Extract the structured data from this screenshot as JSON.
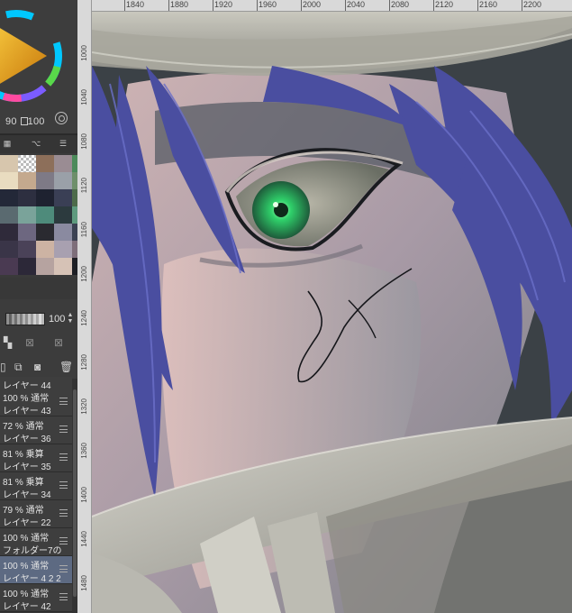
{
  "color_panel": {
    "saturation": "90",
    "brightness": "100",
    "brightness_icon": "square-icon",
    "current_color": "#e0a020"
  },
  "palette_tabs": [
    "grid-icon",
    "branch-icon",
    "sliders-icon"
  ],
  "swatches": [
    [
      "#d7c6ad",
      "#b9a187",
      "#8d6f5a",
      "#9a8c93",
      "#4c8a5a"
    ],
    [
      "#e9dcc0",
      "#c4a98e",
      "#7e7a86",
      "#9aa0a8",
      "#6e8f6a"
    ],
    [
      "#232838",
      "#2d2f40",
      "#1e2230",
      "#3a3f55",
      "#4d6b4a"
    ],
    [
      "#5a6a70",
      "#7aa39a",
      "#4e8b7b",
      "#2c3a3e",
      "#5f9b7f"
    ],
    [
      "#2f2a3a",
      "#6d6780",
      "#2a2a30",
      "#8a8aa0",
      "#3b4152"
    ],
    [
      "#3a3548",
      "#4a4258",
      "#cdb3a3",
      "#a8a0b0",
      "#7e6e7a"
    ],
    [
      "#4a3a52",
      "#2c2838",
      "#b6a3a0",
      "#d6c2b6",
      "#1d1e24"
    ]
  ],
  "layer_panel": {
    "opacity_value": "100",
    "layers": [
      {
        "mode": "",
        "name": "レイヤー 44"
      },
      {
        "mode": "100 %  通常",
        "name": "レイヤー 43"
      },
      {
        "mode": "72 %  通常",
        "name": "レイヤー 36"
      },
      {
        "mode": "81 %  乗算",
        "name": "レイヤー 35"
      },
      {
        "mode": "81 %  乗算",
        "name": "レイヤー 34"
      },
      {
        "mode": "79 %  通常",
        "name": "レイヤー 22"
      },
      {
        "mode": "100 %  通常",
        "name": "フォルダー7の"
      },
      {
        "mode": "100 %  通常",
        "name": "レイヤー 4 2 2",
        "selected": true
      },
      {
        "mode": "100 %  通常",
        "name": "レイヤー 42"
      }
    ]
  },
  "rulers": {
    "horizontal": [
      "1840",
      "1880",
      "1920",
      "1960",
      "2000",
      "2040",
      "2080",
      "2120",
      "2160",
      "2200"
    ],
    "vertical": [
      "1000",
      "1040",
      "1080",
      "1120",
      "1160",
      "1200",
      "1240",
      "1280",
      "1320",
      "1360",
      "1400",
      "1440",
      "1480"
    ]
  },
  "colors": {
    "panel_bg": "#3a3a3a",
    "ruler_bg": "#d9d9d9",
    "selected_layer": "#5d6a82",
    "eye_green": "#2fd06a",
    "hair": "#4a4ea0"
  }
}
